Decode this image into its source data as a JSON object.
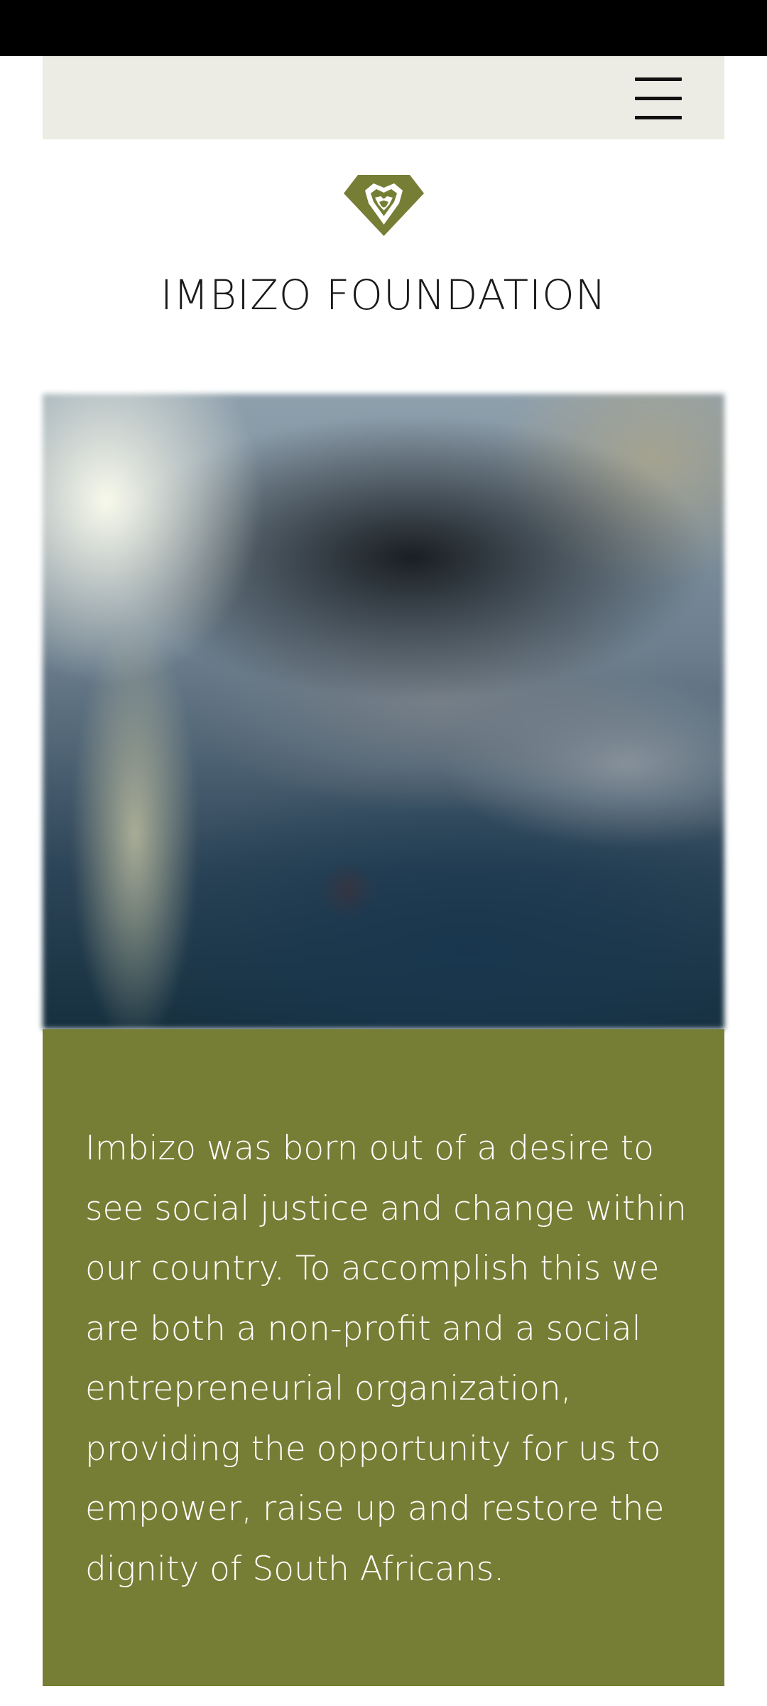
{
  "header": {
    "menu_icon": "hamburger-menu-icon"
  },
  "brand": {
    "logo_icon": "lion-diamond-logo",
    "title": "IMBIZO FOUNDATION",
    "accent_color": "#767e35"
  },
  "hero": {
    "image": "blurred-photo"
  },
  "about": {
    "text": "Imbizo was born out of a desire to\nsee social justice and change within\nour country.  To accomplish this we\nare both a non-profit and a social\nentrepreneurial organization,\nproviding the opportunity for us to\nempower, raise up and restore the\ndignity of South Africans."
  }
}
